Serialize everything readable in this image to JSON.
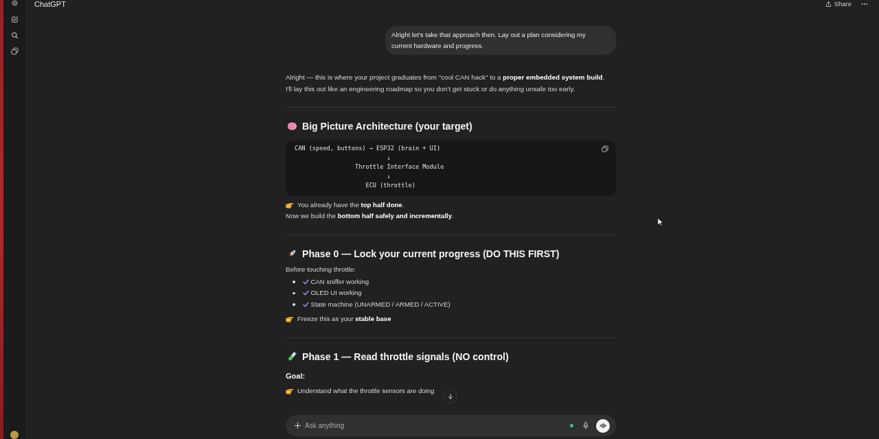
{
  "header": {
    "title": "ChatGPT",
    "share": "Share"
  },
  "user_message": {
    "text": "Alright let's take that approach then. Lay out a plan considering my current hardware and progress."
  },
  "reply": {
    "intro": [
      "Alright — this is where your project graduates from \"cool CAN hack\" to a **proper embedded system build**.",
      "I'll lay this out like an engineering roadmap so you don't get stuck or do anything unsafe too early."
    ],
    "sections": [
      {
        "heading": "Big Picture Architecture (your target)",
        "blocks": [
          {
            "kind": "code",
            "lines": [
              "CAN (speed, buttons) → ESP32 (brain + UI)",
              "                          ↓",
              "                 Throttle Interface Module",
              "                          ↓",
              "                    ECU (throttle)"
            ]
          },
          {
            "kind": "paragraph",
            "lines": [
              {
                "kind": "pointer",
                "text": "You already have the **top half done**."
              },
              {
                "kind": "plain",
                "text": "Now we build the **bottom half safely and incrementally**."
              }
            ]
          }
        ]
      },
      {
        "heading": "Phase 0 — Lock your current progress (DO THIS FIRST)",
        "blocks": [
          {
            "kind": "paragraph",
            "lines": [
              {
                "kind": "plain",
                "text": "Before touching throttle:"
              }
            ]
          },
          {
            "kind": "checklist",
            "items": [
              {
                "text": "CAN sniffer working",
                "checked": true
              },
              {
                "text": "OLED UI working",
                "checked": true
              },
              {
                "text": "State machine (UNARMED / ARMED / ACTIVE)",
                "checked": true
              }
            ]
          },
          {
            "kind": "paragraph",
            "lines": [
              {
                "kind": "pointer",
                "text": "Freeze this as your **stable base**"
              }
            ]
          }
        ]
      },
      {
        "heading": "Phase 1 — Read throttle signals (NO control)",
        "blocks": [
          {
            "kind": "label",
            "text": "Goal:"
          },
          {
            "kind": "paragraph",
            "lines": [
              {
                "kind": "pointer",
                "text": "Understand what the throttle sensors are doing"
              }
            ]
          }
        ]
      }
    ]
  },
  "composer": {
    "placeholder": "Ask anything"
  }
}
